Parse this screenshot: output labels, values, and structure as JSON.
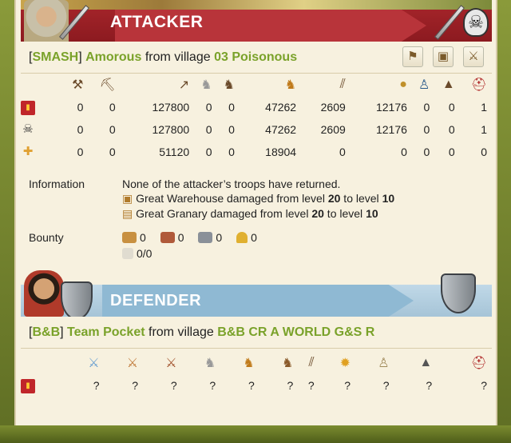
{
  "attacker": {
    "banner_title": "ATTACKER",
    "tribe_tag": "SMASH",
    "player": "Amorous",
    "from_village_text": "from village",
    "village": "03 Poisonous",
    "troop_icons": [
      "hammer-icon",
      "axe-icon",
      "spear-icon",
      "horse-scout-icon",
      "horse-icon",
      "knight-horse-icon",
      "ram-icon",
      "catapult-icon",
      "chief-icon",
      "settler-icon",
      "hero-icon"
    ],
    "rows": [
      {
        "icon": "troops-sent-icon",
        "values": [
          "0",
          "0",
          "127800",
          "0",
          "0",
          "47262",
          "2609",
          "12176",
          "0",
          "0",
          "1"
        ]
      },
      {
        "icon": "dead-troops-icon",
        "values": [
          "0",
          "0",
          "127800",
          "0",
          "0",
          "47262",
          "2609",
          "12176",
          "0",
          "0",
          "1"
        ]
      },
      {
        "icon": "wounded-troops-icon",
        "values": [
          "0",
          "0",
          "51120",
          "0",
          "0",
          "18904",
          "0",
          "0",
          "0",
          "0",
          "0"
        ]
      }
    ],
    "information_label": "Information",
    "information_lines": {
      "line1": "None of the attacker’s troops have returned.",
      "line2_prefix": "Great Warehouse damaged from level ",
      "line2_from": "20",
      "line2_mid": " to level ",
      "line2_to": "10",
      "line3_prefix": "Great Granary damaged from level ",
      "line3_from": "20",
      "line3_mid": " to level ",
      "line3_to": "10"
    },
    "bounty_label": "Bounty",
    "bounty": {
      "lumber": "0",
      "clay": "0",
      "iron": "0",
      "crop": "0",
      "capacity": "0/0"
    }
  },
  "defender": {
    "banner_title": "DEFENDER",
    "tribe_tag": "B&B",
    "player": "Team Pocket",
    "from_village_text": "from village",
    "village": "B&B CR A WORLD G&S R",
    "troop_icons": [
      "sword-icon",
      "sword-icon",
      "sword-icon",
      "horse-icon",
      "horse-icon",
      "horse-icon",
      "ram-icon",
      "fire-icon",
      "chief-icon",
      "settler-icon",
      "hero-icon"
    ],
    "rows": [
      {
        "icon": "troops-sent-icon",
        "values": [
          "?",
          "?",
          "?",
          "?",
          "?",
          "?",
          "?",
          "?",
          "?",
          "?",
          "?"
        ]
      }
    ]
  },
  "colors": {
    "accent_green": "#7aa22a",
    "attacker_red": "#a8262b",
    "defender_blue": "#8fb9d3"
  }
}
